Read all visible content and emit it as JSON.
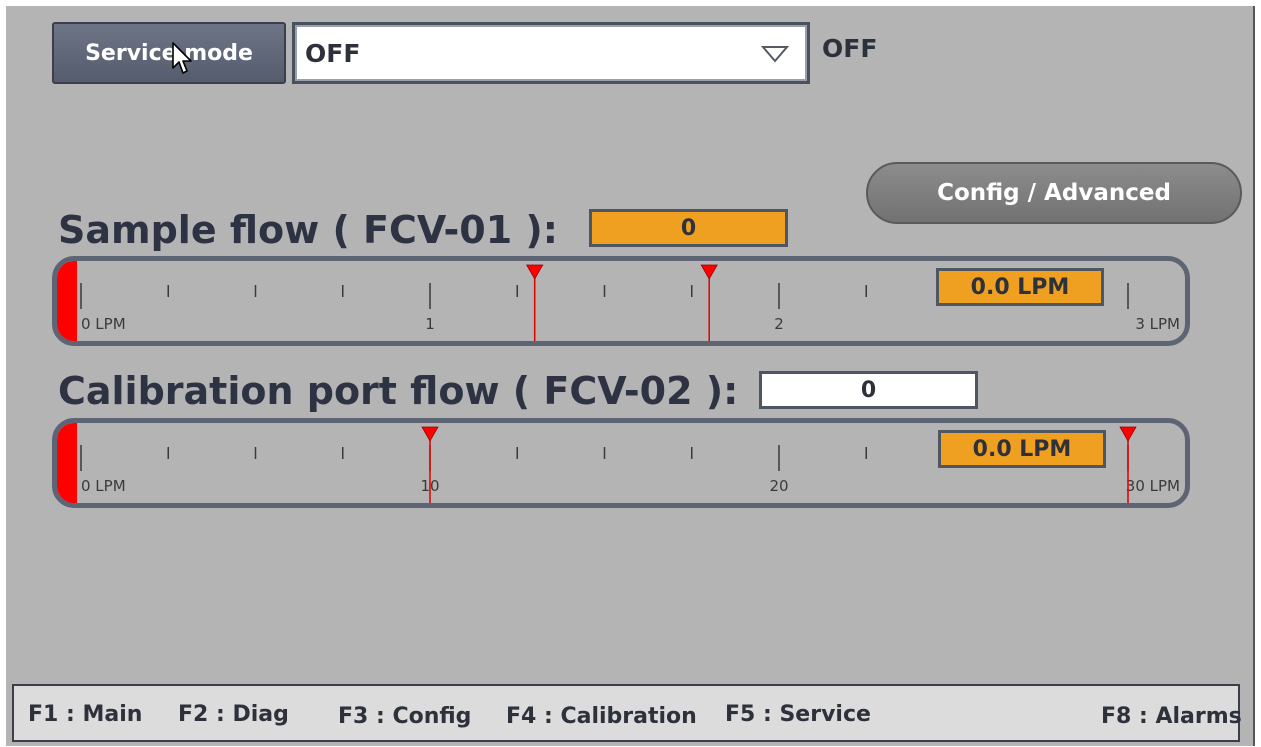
{
  "service": {
    "button_label": "Service mode",
    "select_value": "OFF",
    "status": "OFF"
  },
  "config_button": "Config / Advanced",
  "sample": {
    "title": "Sample flow ( FCV-01 ):",
    "setpoint": "0",
    "readout": "0.0 LPM",
    "scale_max": 3,
    "value": 0.0,
    "limit_markers": [
      1.3,
      1.8
    ],
    "major_labels": [
      "0 LPM",
      "1",
      "2",
      "3 LPM"
    ]
  },
  "calibration": {
    "title": "Calibration port flow ( FCV-02 ):",
    "setpoint": "0",
    "readout": "0.0 LPM",
    "scale_max": 30,
    "value": 0.0,
    "limit_markers": [
      10,
      30
    ],
    "major_labels": [
      "0 LPM",
      "10",
      "20",
      "30 LPM"
    ]
  },
  "function_keys": [
    "F1 : Main",
    "F2 : Diag",
    "F3 : Config",
    "F4 : Calibration",
    "F5 : Service",
    "F8 : Alarms"
  ],
  "colors": {
    "background": "#b4b4b4",
    "accent_orange": "#f0a020",
    "marker_red": "#ff0000",
    "frame_dark": "#5d6473"
  },
  "icons": [
    "chevron-down-icon",
    "mouse-cursor-icon",
    "limit-marker-icon"
  ]
}
